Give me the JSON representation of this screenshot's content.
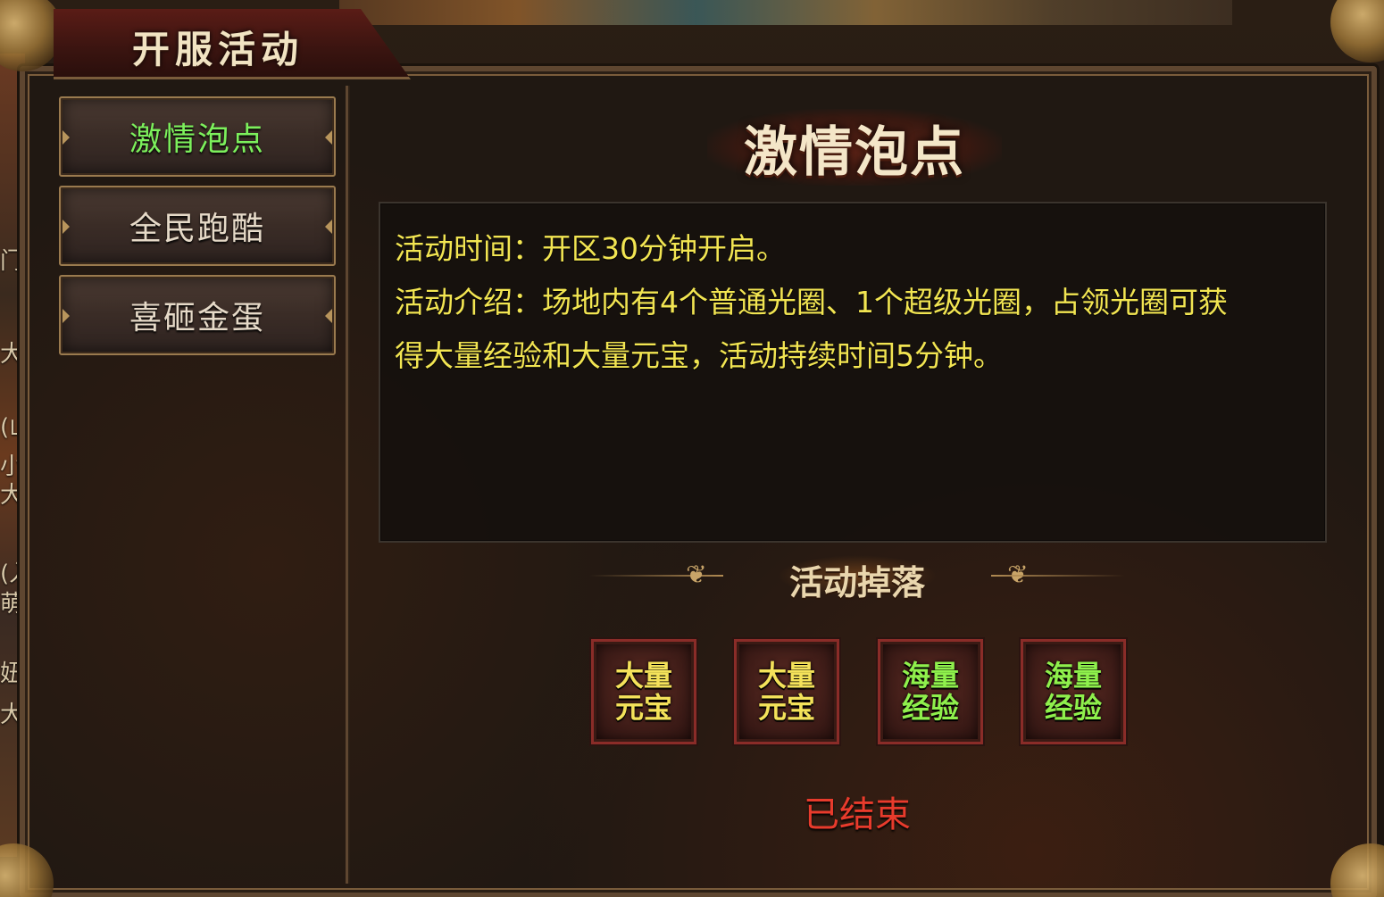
{
  "window": {
    "title": "开服活动"
  },
  "sidebar": {
    "items": [
      {
        "label": "激情泡点",
        "active": true
      },
      {
        "label": "全民跑酷",
        "active": false
      },
      {
        "label": "喜砸金蛋",
        "active": false
      }
    ]
  },
  "activity": {
    "title": "激情泡点",
    "time_line": "活动时间：开区30分钟开启。",
    "intro_line1": "活动介绍：场地内有4个普通光圈、1个超级光圈，占领光圈可获",
    "intro_line2": "得大量经验和大量元宝，活动持续时间5分钟。",
    "drops_title": "活动掉落",
    "rewards": [
      {
        "line1": "大量",
        "line2": "元宝",
        "color": "#f4e25a"
      },
      {
        "line1": "大量",
        "line2": "元宝",
        "color": "#f4e25a"
      },
      {
        "line1": "海量",
        "line2": "经验",
        "color": "#8ff04c"
      },
      {
        "line1": "海量",
        "line2": "经验",
        "color": "#8ff04c"
      }
    ],
    "status": "已结束"
  },
  "background_glyphs": [
    "门",
    "大",
    "(山",
    "小)",
    "大",
    "(入",
    "萌",
    "妞",
    "大"
  ],
  "colors": {
    "active_tab": "#7cf05c",
    "description_text": "#f2e552",
    "status_ended": "#e83b2c",
    "reward_border": "#8a2c28"
  }
}
